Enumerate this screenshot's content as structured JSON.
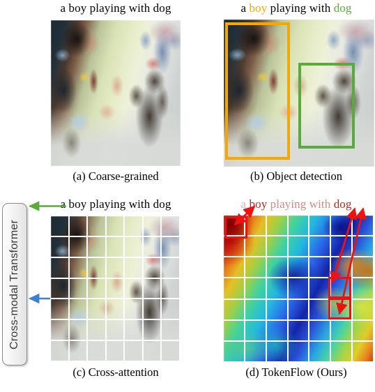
{
  "figure": {
    "colors": {
      "boy_box": "#f5a800",
      "dog_box": "#5aaa3c",
      "attention_box": "#ee1111",
      "text_arrow_green": "#5aaa3c",
      "image_arrow_blue": "#3d7fd6",
      "caption_black": "#000000",
      "transformer_border": "#8a8a8a",
      "transformer_text": "#3a3a3a",
      "tokenflow_light": "#e0a8a0",
      "tokenflow_mid": "#d08c86",
      "tokenflow_dark": "#b02a24"
    },
    "panels": [
      {
        "id": "a",
        "caption": "(a) Coarse-grained",
        "title_words": [
          {
            "text": "a boy playing with dog",
            "color": "#000000"
          }
        ]
      },
      {
        "id": "b",
        "caption": "(b) Object detection",
        "title_words": [
          {
            "text": "a ",
            "color": "#000000"
          },
          {
            "text": "boy",
            "color": "#f5a800"
          },
          {
            "text": " playing with ",
            "color": "#000000"
          },
          {
            "text": "dog",
            "color": "#5aaa3c"
          }
        ],
        "boxes": [
          {
            "label": "boy-bounding-box",
            "color": "#f5a800"
          },
          {
            "label": "dog-bounding-box",
            "color": "#5aaa3c"
          }
        ]
      },
      {
        "id": "c",
        "caption": "(c) Cross-attention",
        "title_words": [
          {
            "text": "a boy playing with dog",
            "color": "#000000"
          }
        ],
        "grid": {
          "rows": 7,
          "cols": 7
        }
      },
      {
        "id": "d",
        "caption": "(d) TokenFlow (Ours)",
        "title_words": [
          {
            "text": "a ",
            "color": "#e3b0ab"
          },
          {
            "text": "boy",
            "color": "#b02a24"
          },
          {
            "text": " playing with ",
            "color": "#d08c86"
          },
          {
            "text": "dog",
            "color": "#b02a24"
          }
        ],
        "grid": {
          "rows": 7,
          "cols": 7
        },
        "highlight_boxes": 3,
        "arrows": 3
      }
    ],
    "transformer": {
      "label": "Cross-modal Transformer"
    }
  }
}
